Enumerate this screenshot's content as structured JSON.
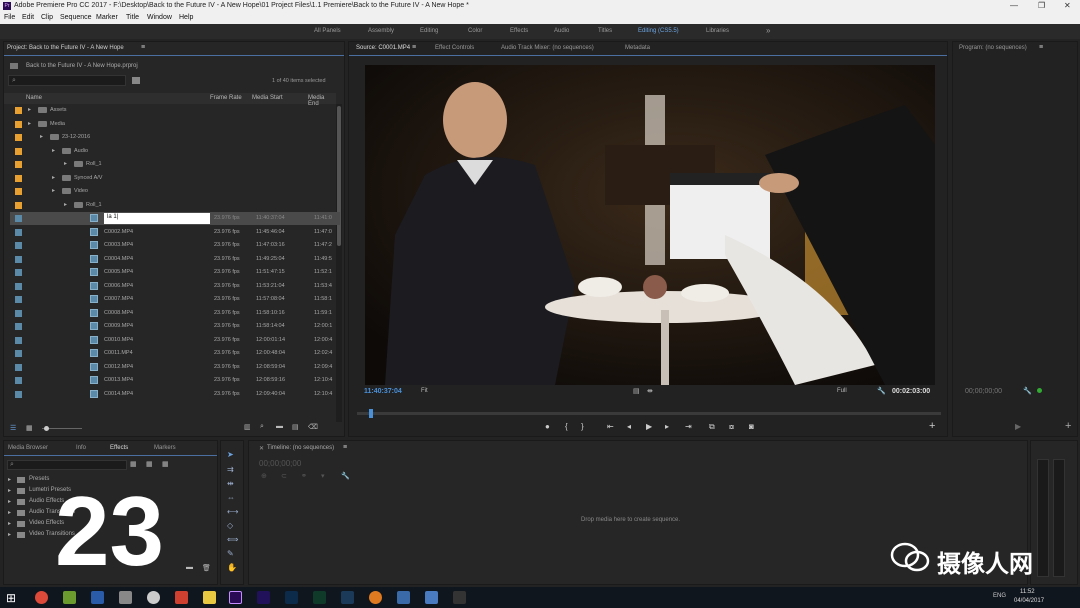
{
  "window": {
    "title": "Adobe Premiere Pro CC 2017 - F:\\Desktop\\Back to the Future IV - A New Hope\\01 Project Files\\1.1 Premiere\\Back to the Future IV - A New Hope *",
    "app_badge": "Pr"
  },
  "menu": [
    "File",
    "Edit",
    "Clip",
    "Sequence",
    "Marker",
    "Title",
    "Window",
    "Help"
  ],
  "workspaces": [
    "All Panels",
    "Assembly",
    "Editing",
    "Color",
    "Effects",
    "Audio",
    "Titles",
    "Editing (CS5.5)",
    "Libraries"
  ],
  "project": {
    "title": "Project: Back to the Future IV - A New Hope",
    "project_file": "Back to the Future IV - A New Hope.prproj",
    "items_selected": "1 of 40 items selected",
    "columns": [
      "Name",
      "Frame Rate",
      "Media Start",
      "Media End"
    ],
    "folders": [
      {
        "name": "Assets",
        "indent": 0
      },
      {
        "name": "Media",
        "indent": 0
      },
      {
        "name": "23-12-2016",
        "indent": 1
      },
      {
        "name": "Audio",
        "indent": 2
      },
      {
        "name": "Roll_1",
        "indent": 3
      },
      {
        "name": "Synced A/V",
        "indent": 2
      },
      {
        "name": "Video",
        "indent": 2
      },
      {
        "name": "Roll_1",
        "indent": 3
      }
    ],
    "rename_value": "la 1|",
    "clips": [
      {
        "name": "C0001.MP4",
        "fps": "23.976 fps",
        "start": "11:40:37:04",
        "end": "11:41:0"
      },
      {
        "name": "C0002.MP4",
        "fps": "23.976 fps",
        "start": "11:45:46:04",
        "end": "11:47:0"
      },
      {
        "name": "C0003.MP4",
        "fps": "23.976 fps",
        "start": "11:47:03:16",
        "end": "11:47:2"
      },
      {
        "name": "C0004.MP4",
        "fps": "23.976 fps",
        "start": "11:49:25:04",
        "end": "11:49:5"
      },
      {
        "name": "C0005.MP4",
        "fps": "23.976 fps",
        "start": "11:51:47:15",
        "end": "11:52:1"
      },
      {
        "name": "C0006.MP4",
        "fps": "23.976 fps",
        "start": "11:53:21:04",
        "end": "11:53:4"
      },
      {
        "name": "C0007.MP4",
        "fps": "23.976 fps",
        "start": "11:57:08:04",
        "end": "11:58:1"
      },
      {
        "name": "C0008.MP4",
        "fps": "23.976 fps",
        "start": "11:58:10:16",
        "end": "11:59:1"
      },
      {
        "name": "C0009.MP4",
        "fps": "23.976 fps",
        "start": "11:58:14:04",
        "end": "12:00:1"
      },
      {
        "name": "C0010.MP4",
        "fps": "23.976 fps",
        "start": "12:00:01:14",
        "end": "12:00:4"
      },
      {
        "name": "C0011.MP4",
        "fps": "23.976 fps",
        "start": "12:00:48:04",
        "end": "12:02:4"
      },
      {
        "name": "C0012.MP4",
        "fps": "23.976 fps",
        "start": "12:08:59:04",
        "end": "12:09:4"
      },
      {
        "name": "C0013.MP4",
        "fps": "23.976 fps",
        "start": "12:08:59:16",
        "end": "12:10:4"
      },
      {
        "name": "C0014.MP4",
        "fps": "23.976 fps",
        "start": "12:09:40:04",
        "end": "12:10:4"
      }
    ]
  },
  "source_monitor": {
    "tabs": [
      "Source: C0001.MP4",
      "Effect Controls",
      "Audio Track Mixer: (no sequences)",
      "Metadata"
    ],
    "timecode_in": "11:40:37:04",
    "fit": "Fit",
    "zoom": "Full",
    "duration": "00:02:03:00",
    "playhead_fraction": 0.02
  },
  "program_monitor": {
    "title": "Program: (no sequences)",
    "timecode": "00;00;00;00"
  },
  "bottom_left": {
    "tabs": [
      "Media Browser",
      "Info",
      "Effects",
      "Markers"
    ],
    "effects": [
      "Presets",
      "Lumetri Presets",
      "Audio Effects",
      "Audio Transitions",
      "Video Effects",
      "Video Transitions"
    ]
  },
  "timeline": {
    "title": "Timeline: (no sequences)",
    "timecode": "00;00;00;00",
    "drop_text": "Drop media here to create sequence."
  },
  "overlay": {
    "step_number": "23",
    "watermark": "摄像人网"
  },
  "taskbar": {
    "time": "11:52",
    "date": "04/04/2017",
    "lang": "ENG"
  },
  "colors": {
    "accent": "#6ba3e0",
    "timecode": "#4a90d9",
    "folder": "#e8a030",
    "clip": "#5a8aa8"
  }
}
